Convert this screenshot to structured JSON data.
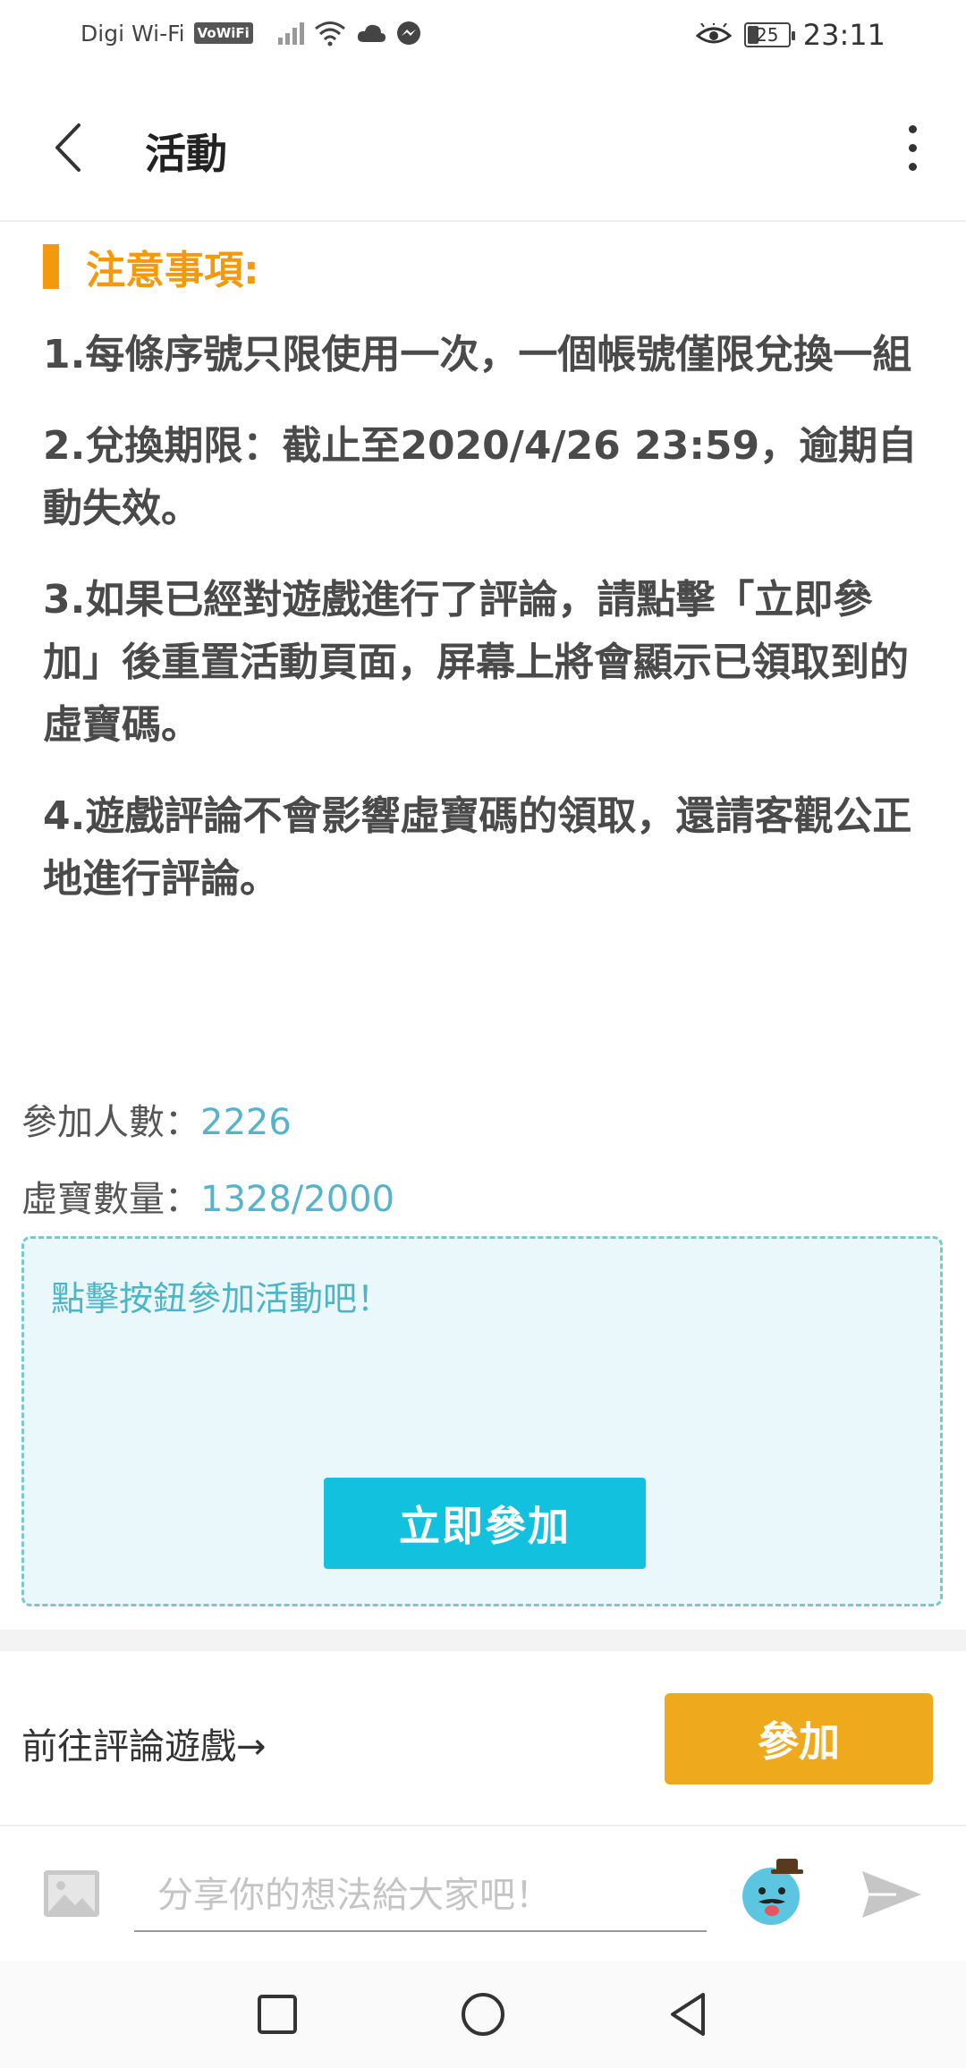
{
  "status_bar": {
    "carrier": "Digi Wi-Fi",
    "vowifi_badge": "VoWiFi",
    "battery_level": "25",
    "time": "23:11"
  },
  "header": {
    "title": "活動"
  },
  "notice": {
    "title": "注意事項:",
    "items": [
      "1.每條序號只限使用一次，一個帳號僅限兌換一組",
      "2.兌換期限：截止至2020/4/26 23:59，逾期自動失效。",
      "3.如果已經對遊戲進行了評論，請點擊「立即參加」後重置活動頁面，屏幕上將會顯示已領取到的虛寶碼。",
      "4.遊戲評論不會影響虛寶碼的領取，還請客觀公正地進行評論。"
    ]
  },
  "stats": {
    "participants_label": "參加人數：",
    "participants_value": "2226",
    "codes_label": "虛寶數量：",
    "codes_value": "1328/2000"
  },
  "join_box": {
    "hint": "點擊按鈕參加活動吧！",
    "button_label": "立即參加"
  },
  "review": {
    "link_label": "前往評論遊戲→",
    "join_button_label": "參加"
  },
  "comment": {
    "placeholder": "分享你的想法給大家吧！"
  },
  "colors": {
    "accent_orange": "#f39a0c",
    "join_button": "#eeaa1c",
    "join_now_button": "#11c1dd",
    "stat_number": "#56b3c9",
    "box_background": "#eaf8fb"
  }
}
